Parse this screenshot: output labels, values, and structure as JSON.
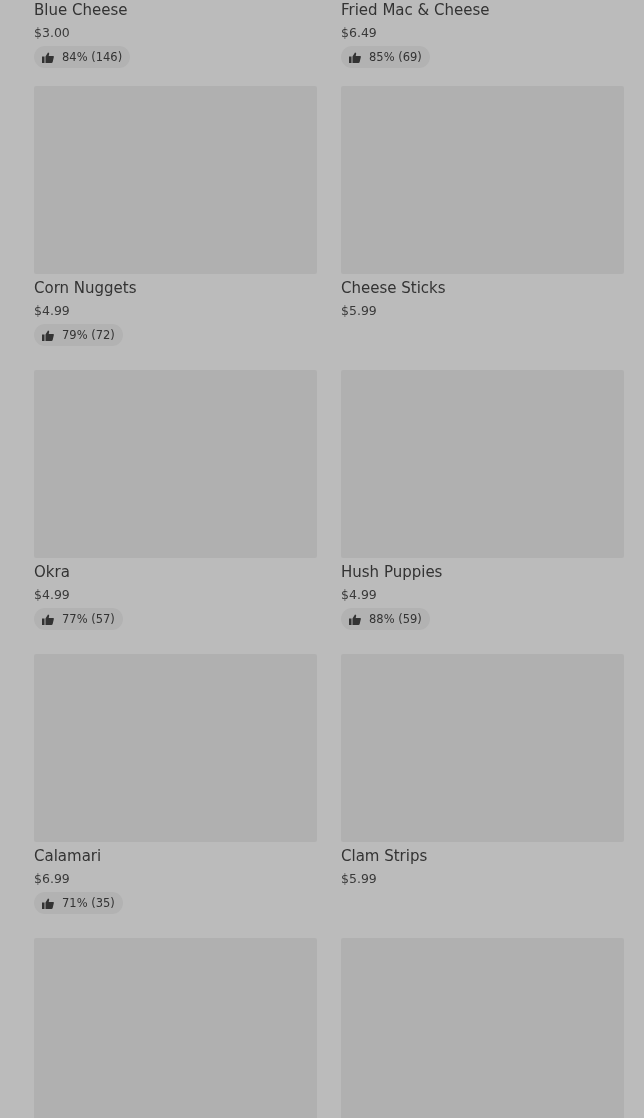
{
  "items": [
    {
      "image": false,
      "name": "Blue Cheese",
      "price": "$3.00",
      "rating": "84% (146)"
    },
    {
      "image": false,
      "name": "Fried Mac & Cheese",
      "price": "$6.49",
      "rating": "85% (69)"
    },
    {
      "image": true,
      "name": "Corn Nuggets",
      "price": "$4.99",
      "rating": "79% (72)"
    },
    {
      "image": true,
      "name": "Cheese Sticks",
      "price": "$5.99"
    },
    {
      "image": true,
      "name": "Okra",
      "price": "$4.99",
      "rating": "77% (57)"
    },
    {
      "image": true,
      "name": "Hush Puppies",
      "price": "$4.99",
      "rating": "88% (59)"
    },
    {
      "image": true,
      "name": "Calamari",
      "price": "$6.99",
      "rating": "71% (35)"
    },
    {
      "image": true,
      "name": "Clam Strips",
      "price": "$5.99"
    },
    {
      "image": true
    },
    {
      "image": true
    }
  ]
}
